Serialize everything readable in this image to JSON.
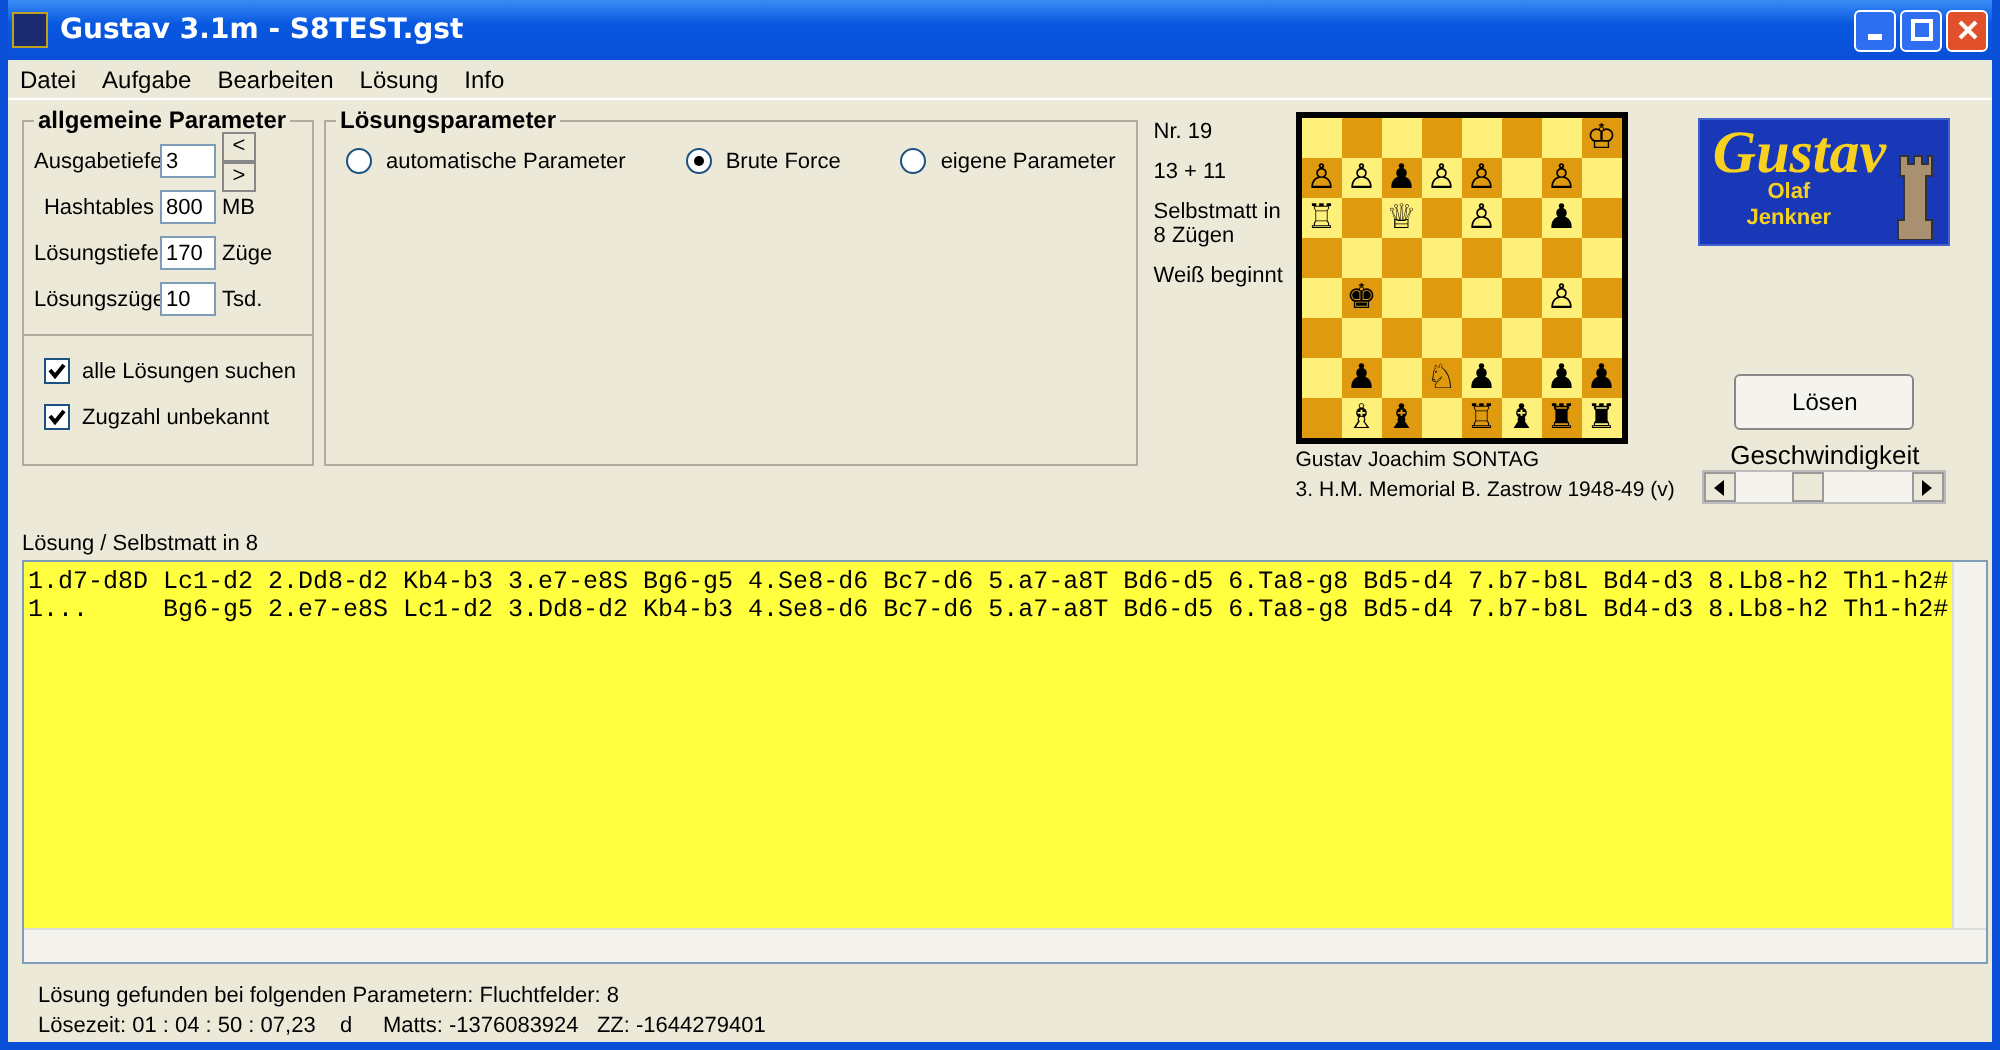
{
  "window": {
    "title": "Gustav 3.1m - S8TEST.gst"
  },
  "menu": [
    {
      "label": "Datei"
    },
    {
      "label": "Aufgabe"
    },
    {
      "label": "Bearbeiten"
    },
    {
      "label": "Lösung"
    },
    {
      "label": "Info"
    }
  ],
  "general_parameters": {
    "title": "allgemeine Parameter",
    "fields": [
      {
        "label": "Ausgabetiefe",
        "value": "3"
      },
      {
        "label": "Hashtables",
        "value": "800",
        "unit": "MB"
      },
      {
        "label": "Lösungstiefe",
        "value": "170",
        "unit": "Züge"
      },
      {
        "label": "Lösungszüge",
        "value": "10",
        "unit": "Tsd."
      }
    ],
    "stepper": {
      "prev": "<",
      "next": ">"
    },
    "checkboxes": [
      {
        "label": "alle Lösungen suchen",
        "checked": true
      },
      {
        "label": "Zugzahl unbekannt",
        "checked": true
      }
    ]
  },
  "solution_parameters": {
    "title": "Lösungsparameter",
    "options": [
      {
        "label": "automatische Parameter",
        "selected": false
      },
      {
        "label": "Brute Force",
        "selected": true
      },
      {
        "label": "eigene Parameter",
        "selected": false
      }
    ]
  },
  "problem": {
    "number": "Nr. 19",
    "count": "13 + 11",
    "stipulation": "Selbstmatt in 8 Zügen",
    "turn": "Weiß beginnt",
    "author": "Gustav Joachim SONTAG",
    "source": "3. H.M. Memorial B. Zastrow 1948-49 (v)"
  },
  "board": [
    [
      {
        "light": true
      },
      {
        "light": false
      },
      {
        "light": true
      },
      {
        "light": false
      },
      {
        "light": true
      },
      {
        "light": false
      },
      {
        "light": true
      },
      {
        "light": false,
        "piece": "♔"
      }
    ],
    [
      {
        "light": false,
        "piece": "♙"
      },
      {
        "light": true,
        "piece": "♙"
      },
      {
        "light": false,
        "piece": "♟"
      },
      {
        "light": true,
        "piece": "♙"
      },
      {
        "light": false,
        "piece": "♙"
      },
      {
        "light": true
      },
      {
        "light": false,
        "piece": "♙"
      },
      {
        "light": true
      }
    ],
    [
      {
        "light": true,
        "piece": "♖"
      },
      {
        "light": false
      },
      {
        "light": true,
        "piece": "♕"
      },
      {
        "light": false
      },
      {
        "light": true,
        "piece": "♙"
      },
      {
        "light": false
      },
      {
        "light": true,
        "piece": "♟"
      },
      {
        "light": false
      }
    ],
    [
      {
        "light": false
      },
      {
        "light": true
      },
      {
        "light": false
      },
      {
        "light": true
      },
      {
        "light": false
      },
      {
        "light": true
      },
      {
        "light": false
      },
      {
        "light": true
      }
    ],
    [
      {
        "light": true
      },
      {
        "light": false,
        "piece": "♚"
      },
      {
        "light": true
      },
      {
        "light": false
      },
      {
        "light": true
      },
      {
        "light": false
      },
      {
        "light": true,
        "piece": "♙"
      },
      {
        "light": false
      }
    ],
    [
      {
        "light": false
      },
      {
        "light": true
      },
      {
        "light": false
      },
      {
        "light": true
      },
      {
        "light": false
      },
      {
        "light": true
      },
      {
        "light": false
      },
      {
        "light": true
      }
    ],
    [
      {
        "light": true
      },
      {
        "light": false,
        "piece": "♟"
      },
      {
        "light": true
      },
      {
        "light": false,
        "piece": "♘"
      },
      {
        "light": true,
        "piece": "♟"
      },
      {
        "light": false
      },
      {
        "light": true,
        "piece": "♟"
      },
      {
        "light": false,
        "piece": "♟"
      }
    ],
    [
      {
        "light": false
      },
      {
        "light": true,
        "piece": "♗"
      },
      {
        "light": false,
        "piece": "♝"
      },
      {
        "light": true
      },
      {
        "light": false,
        "piece": "♖"
      },
      {
        "light": true,
        "piece": "♝"
      },
      {
        "light": false,
        "piece": "♜"
      },
      {
        "light": true,
        "piece": "♜"
      }
    ]
  ],
  "logo": {
    "title": "Gustav",
    "subtitle": "Olaf Jenkner"
  },
  "solve_button": "Lösen",
  "speed": {
    "label": "Geschwindigkeit",
    "level": 0.4
  },
  "solution": {
    "caption": "Lösung / Selbstmatt in 8",
    "lines": [
      "1.d7-d8D Lc1-d2 2.Dd8-d2 Kb4-b3 3.e7-e8S Bg6-g5 4.Se8-d6 Bc7-d6 5.a7-a8T Bd6-d5 6.Ta8-g8 Bd5-d4 7.b7-b8L Bd4-d3 8.Lb8-h2 Th1-h2#",
      "1...     Bg6-g5 2.e7-e8S Lc1-d2 3.Dd8-d2 Kb4-b3 4.Se8-d6 Bc7-d6 5.a7-a8T Bd6-d5 6.Ta8-g8 Bd5-d4 7.b7-b8L Bd4-d3 8.Lb8-h2 Th1-h2#"
    ]
  },
  "status": [
    "Lösung gefunden bei folgenden Parametern: Fluchtfelder: 8",
    "Lösezeit: 01 : 04 : 50 : 07,23    d     Matts: -1376083924   ZZ: -1644279401"
  ]
}
